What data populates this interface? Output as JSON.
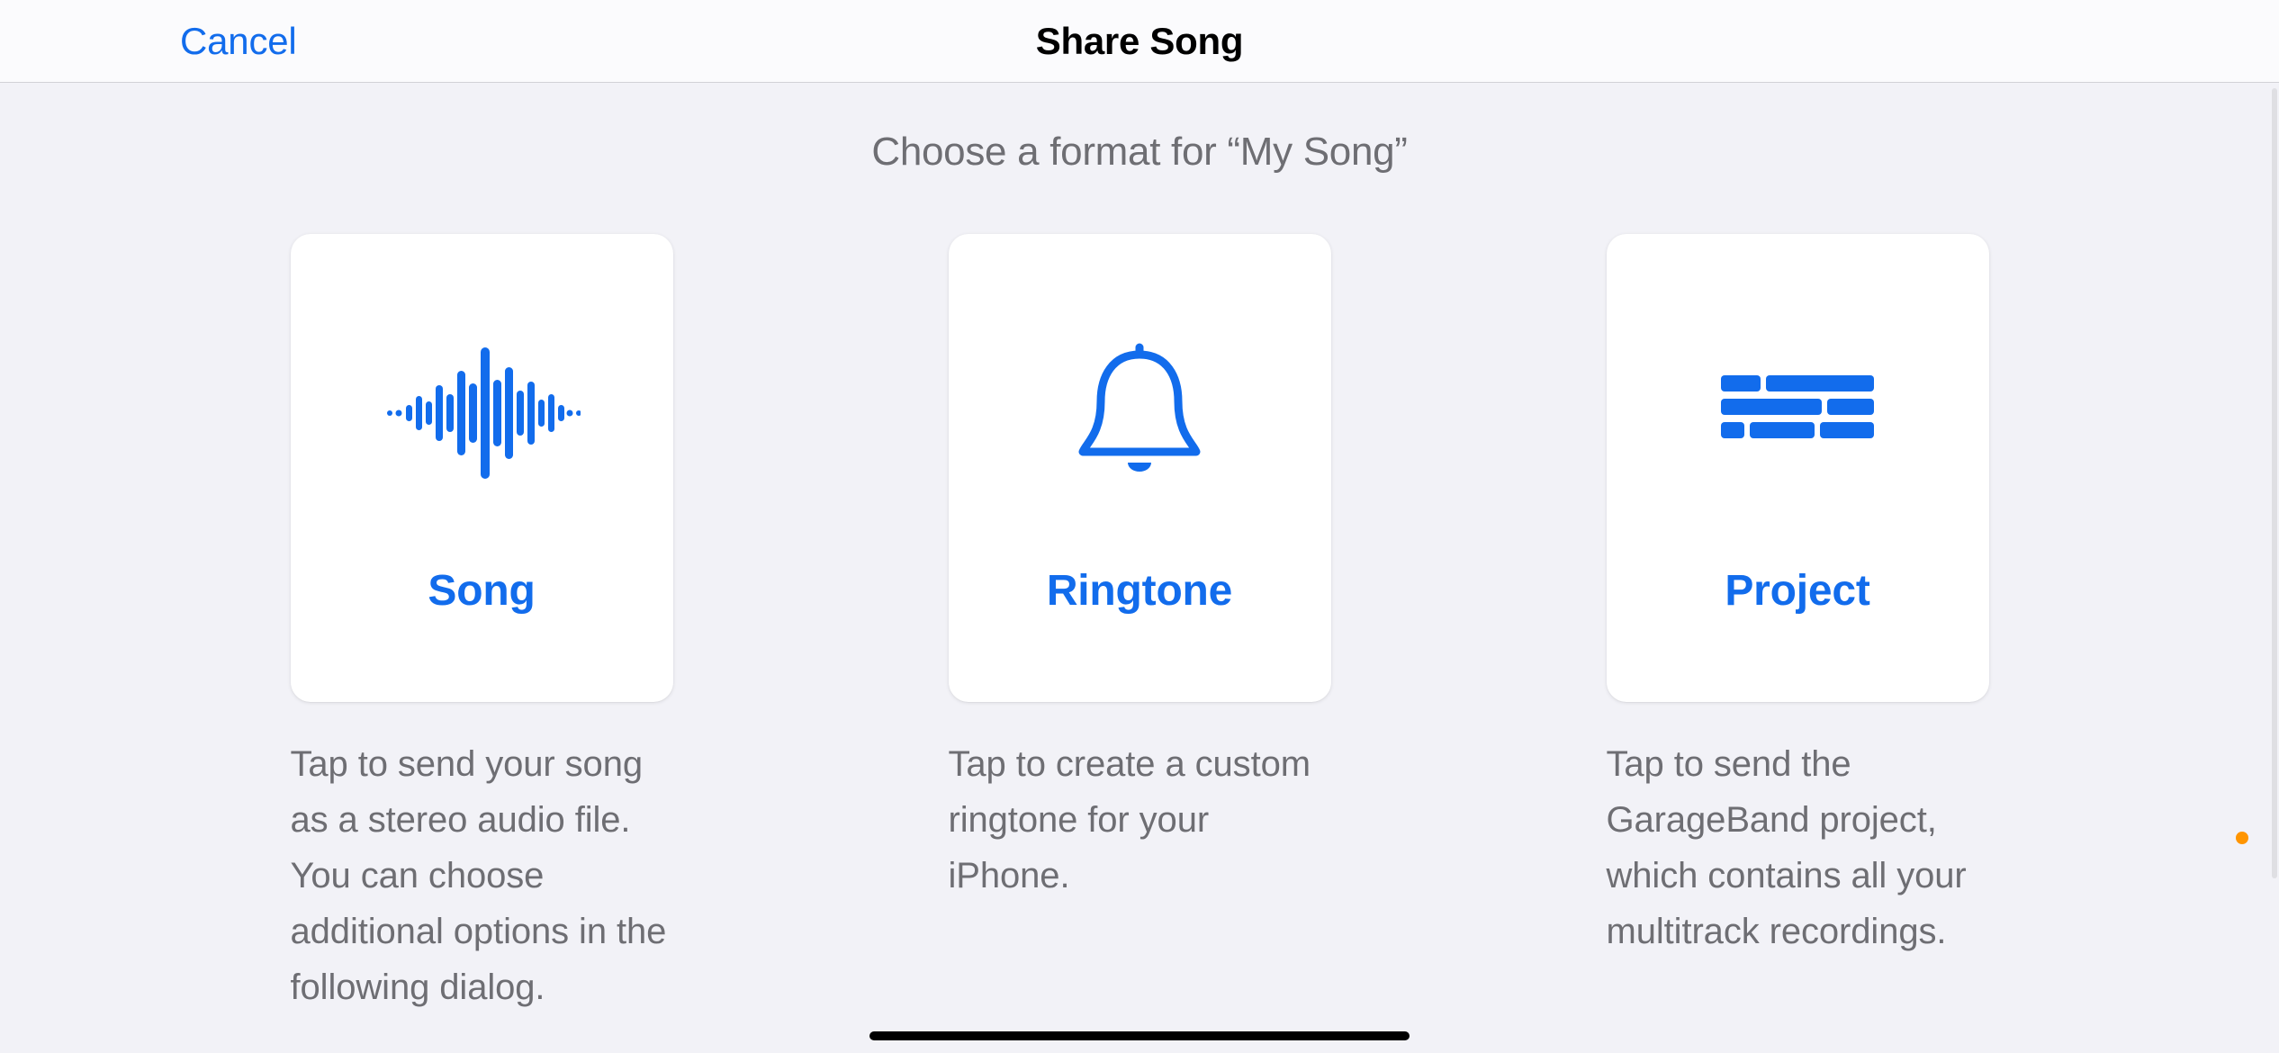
{
  "nav": {
    "cancel_label": "Cancel",
    "title": "Share Song"
  },
  "prompt": "Choose a format for “My Song”",
  "cards": {
    "song": {
      "label": "Song",
      "description": "Tap to send your song as a stereo audio file. You can choose additional options in the following dialog."
    },
    "ringtone": {
      "label": "Ringtone",
      "description": "Tap to create a custom ringtone for your iPhone."
    },
    "project": {
      "label": "Project",
      "description": "Tap to send the GarageBand project, which contains all your multitrack recordings."
    }
  },
  "colors": {
    "accent": "#126cec",
    "text_secondary": "#6e6e73",
    "card_bg": "#ffffff",
    "page_bg": "#f2f2f7"
  }
}
